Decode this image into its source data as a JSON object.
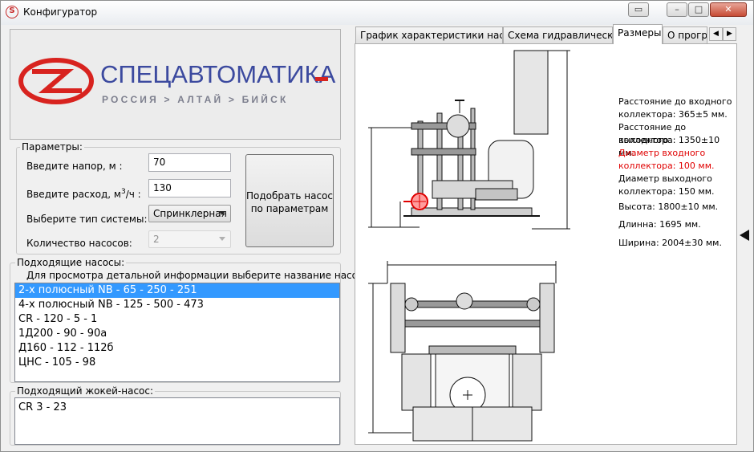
{
  "window": {
    "title": "Конфигуратор"
  },
  "logo": {
    "title": "СПЕЦАВТОМАТИКА",
    "subtitle": "РОССИЯ > АЛТАЙ > БИЙСК"
  },
  "params": {
    "group_label": "Параметры:",
    "head_label": "Введите напор, м :",
    "head_value": "70",
    "flow_label_pre": "Введите расход, м",
    "flow_label_sup": "3",
    "flow_label_post": "/ч :",
    "flow_value": "130",
    "system_label": "Выберите тип системы:",
    "system_value": "Спринклерная",
    "pumps_label": "Количество насосов:",
    "pumps_value": "2",
    "select_button": "Подобрать насос по параметрам"
  },
  "pumps": {
    "group_label": "Подходящие насосы:",
    "hint": "Для просмотра детальной информации выберите название насоса.",
    "items": [
      "2-х полюсный NB - 65 - 250 - 251",
      "4-х полюсный NB - 125 - 500 - 473",
      "CR - 120 - 5 - 1",
      "1Д200 - 90 - 90а",
      "Д160 - 112 - 112б",
      "ЦНС - 105 - 98"
    ]
  },
  "jockey": {
    "group_label": "Подходящий жокей-насос:",
    "value": "CR 3 - 23"
  },
  "tabs": {
    "items": [
      "График характеристики насоса",
      "Схема гидравлическая",
      "Размеры",
      "О прогр"
    ],
    "active": "Размеры"
  },
  "dimensions": {
    "inlet_line1": "Расстояние до входного",
    "inlet_line2": "коллектора: 365±5 мм.",
    "outlet_line1": "Расстояние до выходного",
    "outlet_line2": "коллектора: 1350±10 мм.",
    "inlet_diam_line1": "Диаметр входного",
    "inlet_diam_line2": "коллектора: 100 мм.",
    "outlet_diam_line1": "Диаметр выходного",
    "outlet_diam_line2": "коллектора: 150 мм.",
    "height": "Высота: 1800±10 мм.",
    "length": "Длинна: 1695 мм.",
    "width": "Ширина: 2004±30 мм."
  },
  "colors": {
    "accent_red": "#d8231f",
    "logo_blue": "#3c4a9f",
    "selection": "#3399ff"
  }
}
